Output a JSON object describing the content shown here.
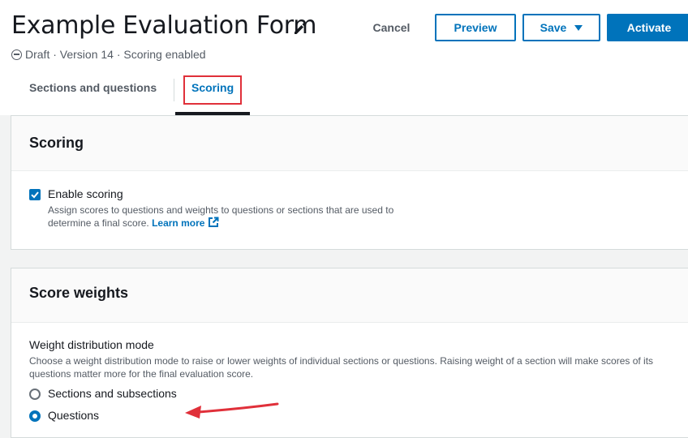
{
  "header": {
    "title": "Example Evaluation Form",
    "status": "Draft · Version 14 · Scoring enabled",
    "cancel_label": "Cancel",
    "preview_label": "Preview",
    "save_label": "Save",
    "activate_label": "Activate"
  },
  "tabs": [
    {
      "label": "Sections and questions",
      "selected": false
    },
    {
      "label": "Scoring",
      "selected": true
    }
  ],
  "scoring_panel": {
    "title": "Scoring",
    "checkbox_label": "Enable scoring",
    "checkbox_checked": true,
    "description": "Assign scores to questions and weights to questions or sections that are used to determine a final score.",
    "learn_more": "Learn more"
  },
  "weights_panel": {
    "title": "Score weights",
    "field_label": "Weight distribution mode",
    "description": "Choose a weight distribution mode to raise or lower weights of individual sections or questions. Raising weight of a section will make scores of its questions matter more for the final evaluation score.",
    "options": [
      {
        "label": "Sections and subsections",
        "selected": false
      },
      {
        "label": "Questions",
        "selected": true
      }
    ]
  },
  "icons": {
    "edit": "pencil-icon",
    "status": "minus-circle-icon",
    "save_menu": "caret-down-icon",
    "check": "checkmark-icon",
    "external": "external-link-icon",
    "annotation": "red-arrow-icon"
  },
  "colors": {
    "accent": "#0073bb",
    "highlight": "#e0303a",
    "text": "#16191f",
    "muted": "#545b64"
  }
}
